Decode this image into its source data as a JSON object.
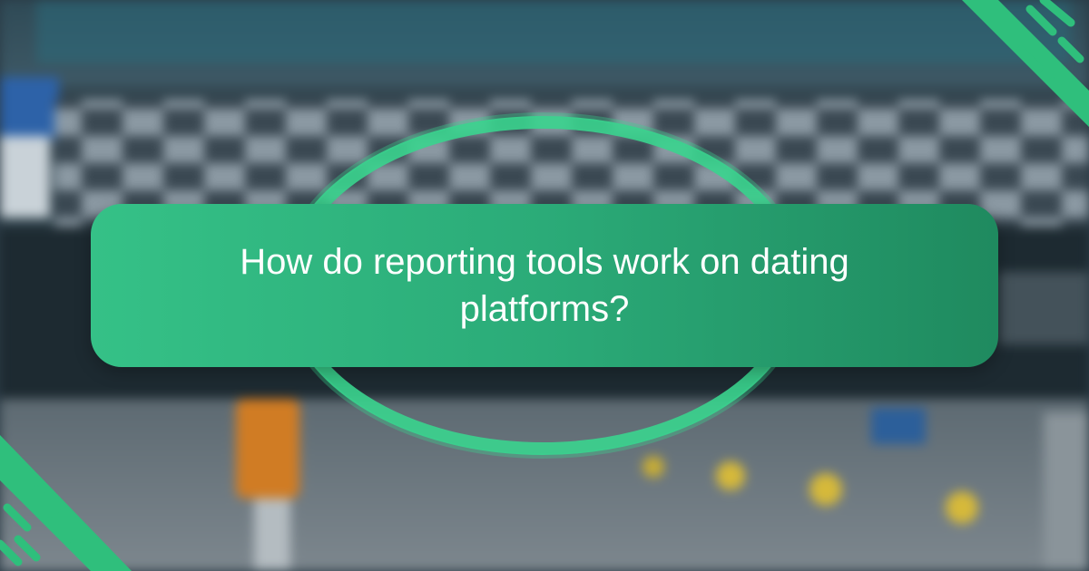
{
  "title": "How do reporting tools work on dating platforms?",
  "colors": {
    "accent": "#35c187",
    "accent_dark": "#1f8a5f",
    "text": "#ffffff",
    "ring": "#3ad48e"
  },
  "decorations": {
    "background": "blurred-stadium-photo",
    "top_right": "green-dash-stripes",
    "bottom_left": "green-dash-stripes"
  }
}
